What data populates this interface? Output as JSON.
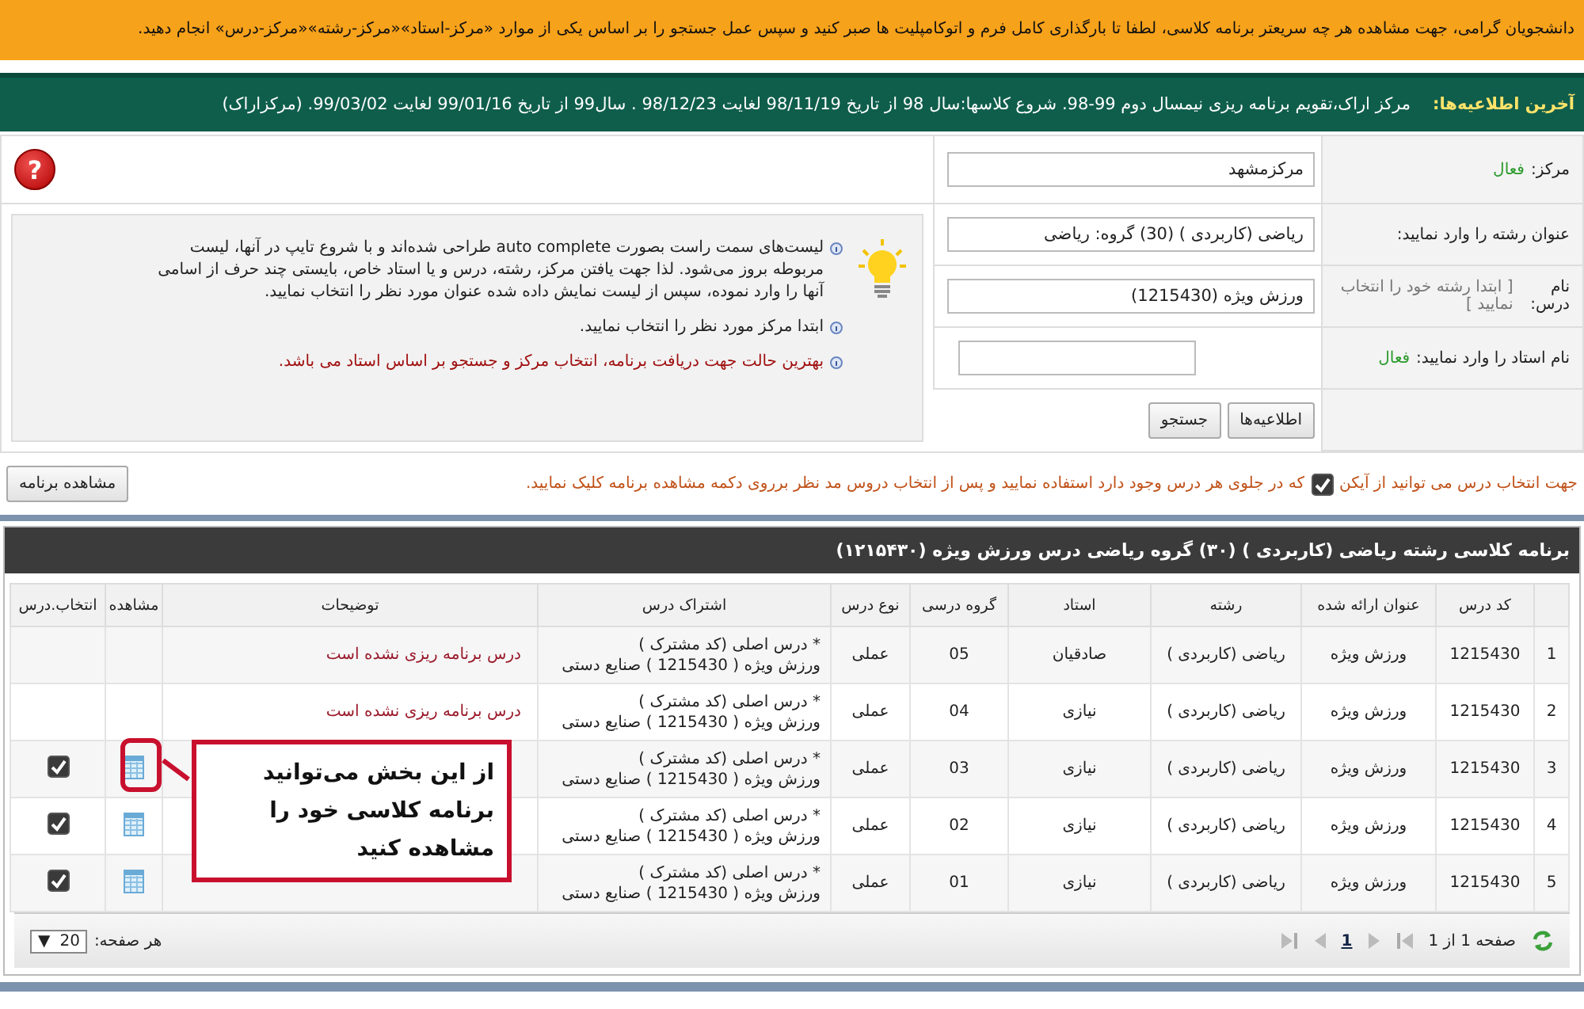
{
  "banner": "دانشجویان گرامی، جهت مشاهده هر چه سریعتر برنامه کلاسی، لطفا تا بارگذاری کامل فرم و اتوکامپلیت ها صبر کنید و سپس عمل جستجو را بر اساس یکی از موارد «مرکز-استاد»«مرکز-رشته»«مرکز-درس» انجام دهید.",
  "news": {
    "label": "آخرین اطلاعیه‌ها:",
    "text": "مرکز اراک،تقویم برنامه ریزی نیمسال دوم 99-98. شروع کلاسها:سال 98 از تاریخ 98/11/19 لغایت 98/12/23 . سال99 از تاریخ 99/01/16 لغایت 99/03/02. (مرکزاراک)"
  },
  "form": {
    "fields": [
      {
        "label": "مرکز:",
        "status": "فعال",
        "value": "مرکزمشهد",
        "wide": true
      },
      {
        "label": "عنوان رشته را وارد نمایید:",
        "value": "ریاضی (کاربردی ) (30) گروه: ریاضی",
        "wide": true
      },
      {
        "label": "نام درس:",
        "hint": "[ ابتدا رشته خود را انتخاب نمایید ]",
        "value": "ورزش ویژه (1215430)",
        "wide": true
      },
      {
        "label": "نام استاد را وارد نمایید:",
        "status": "فعال",
        "wide": false
      }
    ],
    "buttons": [
      "اطلاعیه‌ها",
      "جستجو"
    ],
    "help": "?",
    "tips": [
      {
        "kind": "info",
        "text": "لیست‌های سمت راست بصورت auto complete طراحی شده‌اند و با شروع تایپ در آنها، لیست مربوطه بروز می‌شود. لذا جهت یافتن مرکز، رشته، درس و یا استاد خاص، بایستی چند حرف از اسامی آنها را وارد نموده، سپس از لیست نمایش داده شده عنوان مورد نظر را انتخاب نمایید."
      },
      {
        "kind": "info",
        "text": "ابتدا مرکز مورد نظر را انتخاب نمایید."
      },
      {
        "kind": "warning",
        "text": "بهترین حالت جهت دریافت برنامه، انتخاب مرکز و جستجو بر اساس استاد می باشد."
      }
    ]
  },
  "instruction": {
    "before": "جهت انتخاب درس می توانید از آیکن",
    "after": "که در جلوی هر درس وجود دارد استفاده نمایید و پس از انتخاب دروس مد نظر برروی دکمه مشاهده برنامه کلیک نمایید.",
    "button": "مشاهده برنامه"
  },
  "table": {
    "title": "برنامه کلاسی رشته ریاضی (کاربردی ) (۳۰) گروه ریاضی درس ورزش ویژه (۱۲۱۵۴۳۰)",
    "columns": [
      "کد درس",
      "عنوان ارائه شده",
      "رشته",
      "استاد",
      "گروه درسی",
      "نوع درس",
      "اشتراک درس",
      "توضیحات",
      "مشاهده",
      "انتخاب.درس"
    ],
    "rows": [
      {
        "index": "1",
        "code": "1215430",
        "title": "ورزش ویژه",
        "field": "ریاضی (کاربردی )",
        "teacher": "صادقیان",
        "group": "05",
        "type": "عملی",
        "share": [
          "* درس اصلی (کد مشترک )",
          "ورزش ویژه ( 1215430 ) صنایع دستی"
        ],
        "note": "درس برنامه ریزی نشده است",
        "view_icon": false
      },
      {
        "index": "2",
        "code": "1215430",
        "title": "ورزش ویژه",
        "field": "ریاضی (کاربردی )",
        "teacher": "نیازی",
        "group": "04",
        "type": "عملی",
        "share": [
          "* درس اصلی (کد مشترک )",
          "ورزش ویژه ( 1215430 ) صنایع دستی"
        ],
        "note": "درس برنامه ریزی نشده است",
        "view_icon": false
      },
      {
        "index": "3",
        "code": "1215430",
        "title": "ورزش ویژه",
        "field": "ریاضی (کاربردی )",
        "teacher": "نیازی",
        "group": "03",
        "type": "عملی",
        "share": [
          "* درس اصلی (کد مشترک )",
          "ورزش ویژه ( 1215430 ) صنایع دستی"
        ],
        "view_icon": true,
        "checked": true
      },
      {
        "index": "4",
        "code": "1215430",
        "title": "ورزش ویژه",
        "field": "ریاضی (کاربردی )",
        "teacher": "نیازی",
        "group": "02",
        "type": "عملی",
        "share": [
          "* درس اصلی (کد مشترک )",
          "ورزش ویژه ( 1215430 ) صنایع دستی"
        ],
        "view_icon": true,
        "checked": true
      },
      {
        "index": "5",
        "code": "1215430",
        "title": "ورزش ویژه",
        "field": "ریاضی (کاربردی )",
        "teacher": "نیازی",
        "group": "01",
        "type": "عملی",
        "share": [
          "* درس اصلی (کد مشترک )",
          "ورزش ویژه ( 1215430 ) صنایع دستی"
        ],
        "view_icon": true,
        "checked": true
      }
    ],
    "pager": {
      "page_info": "صفحه 1 از 1",
      "page": "1",
      "per_page_label": "هر صفحه:",
      "per_page": "20",
      "caret": "▼"
    }
  },
  "callout": {
    "text": "از این بخش می‌توانید برنامه کلاسی خود را مشاهده کنید"
  }
}
